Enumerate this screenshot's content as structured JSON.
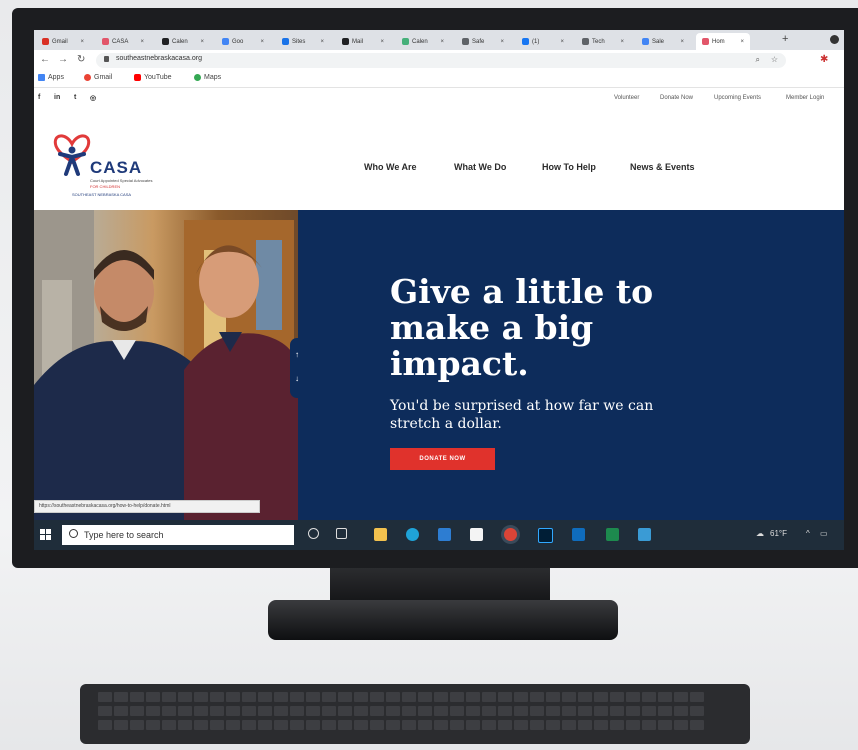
{
  "browser": {
    "tabs": [
      {
        "label": "Gmail",
        "color": "#d93025"
      },
      {
        "label": "CASA",
        "color": "#e2566a"
      },
      {
        "label": "Calen",
        "color": "#202124"
      },
      {
        "label": "Goo",
        "color": "#4285f4"
      },
      {
        "label": "Sites",
        "color": "#1a73e8"
      },
      {
        "label": "Mail",
        "color": "#202124"
      },
      {
        "label": "Calen",
        "color": "#46b07a"
      },
      {
        "label": "Safe",
        "color": "#5f6368"
      },
      {
        "label": "(1)",
        "color": "#1877f2"
      },
      {
        "label": "Tech",
        "color": "#5f6368"
      },
      {
        "label": "Sale",
        "color": "#4285f4"
      },
      {
        "label": "Hom",
        "color": "#e2566a"
      }
    ],
    "url": "southeastnebraskacasa.org",
    "bookmarks": [
      "Apps",
      "Gmail",
      "YouTube",
      "Maps"
    ]
  },
  "site": {
    "utility_links": [
      "Volunteer",
      "Donate Now",
      "Upcoming Events",
      "Member Login"
    ],
    "logo": {
      "word": "CASA",
      "tagline": "Court Appointed Special Advocates",
      "for_children": "FOR CHILDREN",
      "region": "SOUTHEAST NEBRASKA CASA"
    },
    "nav": [
      "Who We Are",
      "What We Do",
      "How To Help",
      "News & Events"
    ],
    "hero": {
      "headline": "Give a little to make a big impact.",
      "subtext": "You'd be surprised at how far we can stretch a dollar.",
      "cta": "DONATE NOW"
    },
    "status_url": "https://southeastnebraskacasa.org/how-to-help/donate.html"
  },
  "taskbar": {
    "search_placeholder": "Type here to search",
    "temperature": "61°F"
  },
  "colors": {
    "hero_blue": "#0d2c5b",
    "cta_red": "#e0322c",
    "logo_blue": "#1f3a7a"
  }
}
